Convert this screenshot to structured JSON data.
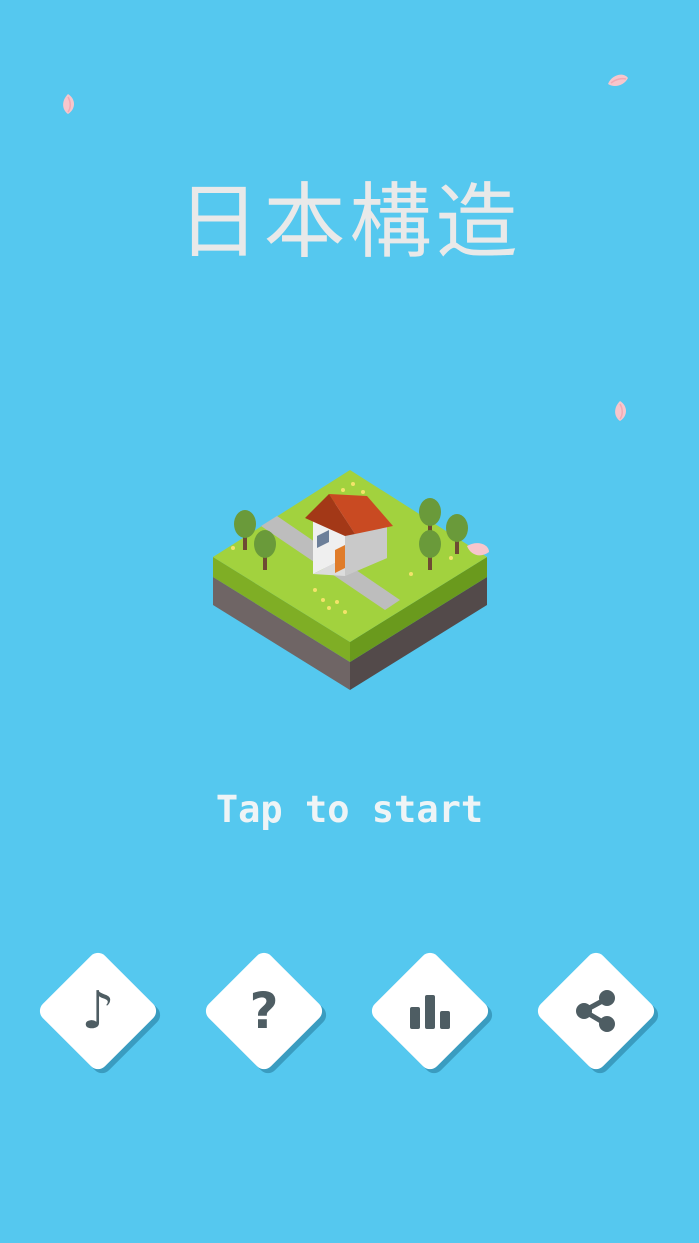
{
  "title": "日本構造",
  "start_prompt": "Tap to start",
  "colors": {
    "background": "#55c8ef",
    "button_face": "#ffffff",
    "button_shadow": "#3a9cc0",
    "icon": "#4e5d63"
  },
  "buttons": [
    {
      "name": "music",
      "icon": "music-note-icon",
      "glyph": "♪"
    },
    {
      "name": "help",
      "icon": "question-mark-icon",
      "glyph": "?"
    },
    {
      "name": "leaderboard",
      "icon": "bar-chart-icon",
      "glyph": ""
    },
    {
      "name": "share",
      "icon": "share-icon",
      "glyph": ""
    }
  ]
}
